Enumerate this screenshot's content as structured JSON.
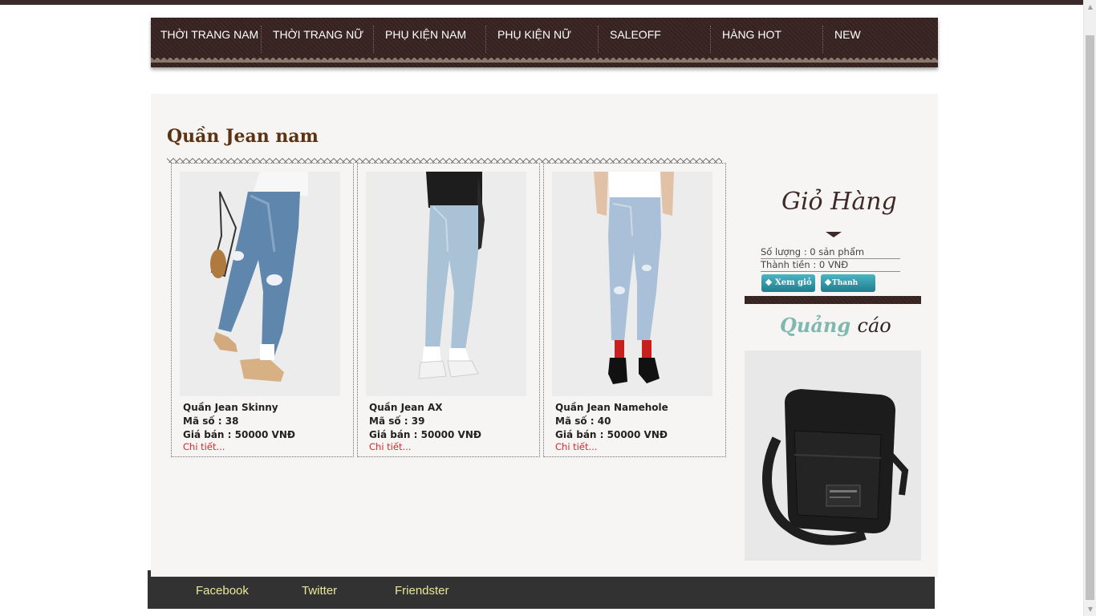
{
  "nav": {
    "items": [
      {
        "label": "THỜI TRANG NAM"
      },
      {
        "label": "THỜI TRANG NỮ"
      },
      {
        "label": "PHỤ KIỆN NAM"
      },
      {
        "label": "PHỤ KIỆN NỮ"
      },
      {
        "label": "SALEOFF"
      },
      {
        "label": "HÀNG HOT"
      },
      {
        "label": "NEW"
      }
    ]
  },
  "section": {
    "title": "Quần Jean nam"
  },
  "products": [
    {
      "name": "Quần Jean Skinny",
      "code": "Mã số : 38",
      "price": "Giá bán : 50000 VNĐ",
      "detail": "Chi tiết..."
    },
    {
      "name": "Quần Jean AX",
      "code": "Mã số : 39",
      "price": "Giá bán : 50000 VNĐ",
      "detail": "Chi tiết..."
    },
    {
      "name": "Quần Jean Namehole",
      "code": "Mã số : 40",
      "price": "Giá bán : 50000 VNĐ",
      "detail": "Chi tiết..."
    }
  ],
  "cart": {
    "title": "Giỏ Hàng",
    "quantity": "Số lượng : 0 sản phẩm",
    "total": "Thành tiền : 0 VNĐ",
    "view_label": "Xem giỏ",
    "checkout_label": "Thanh toán"
  },
  "ads": {
    "title_a": "Quảng",
    "title_b": "cáo"
  },
  "footer": {
    "links": [
      {
        "label": "Facebook"
      },
      {
        "label": "Twitter"
      },
      {
        "label": "Friendster"
      }
    ]
  },
  "colors": {
    "nav_bg": "#3d2928",
    "title": "#5b3212",
    "link_red": "#e0232a",
    "footer_bg": "#323232",
    "footer_link": "#e9e89a",
    "button": "#2a8c9c"
  }
}
